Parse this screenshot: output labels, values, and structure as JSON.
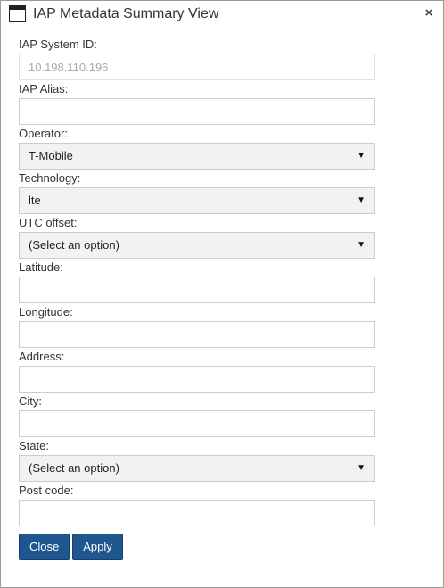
{
  "window": {
    "title": "IAP Metadata Summary View",
    "close_glyph": "×",
    "icon": "window-icon"
  },
  "form": {
    "system_id": {
      "label": "IAP System ID:",
      "value": "10.198.110.196"
    },
    "alias": {
      "label": "IAP Alias:",
      "value": ""
    },
    "operator": {
      "label": "Operator:",
      "selected": "T-Mobile"
    },
    "technology": {
      "label": "Technology:",
      "selected": "lte"
    },
    "utc_offset": {
      "label": "UTC offset:",
      "selected": "(Select an option)"
    },
    "latitude": {
      "label": "Latitude:",
      "value": ""
    },
    "longitude": {
      "label": "Longitude:",
      "value": ""
    },
    "address": {
      "label": "Address:",
      "value": ""
    },
    "city": {
      "label": "City:",
      "value": ""
    },
    "state": {
      "label": "State:",
      "selected": "(Select an option)"
    },
    "post_code": {
      "label": "Post code:",
      "value": ""
    }
  },
  "buttons": {
    "close": "Close",
    "apply": "Apply"
  },
  "colors": {
    "button_bg": "#1f5690",
    "select_bg": "#f2f2f2",
    "border": "#cccccc"
  },
  "caret_glyph": "▼"
}
